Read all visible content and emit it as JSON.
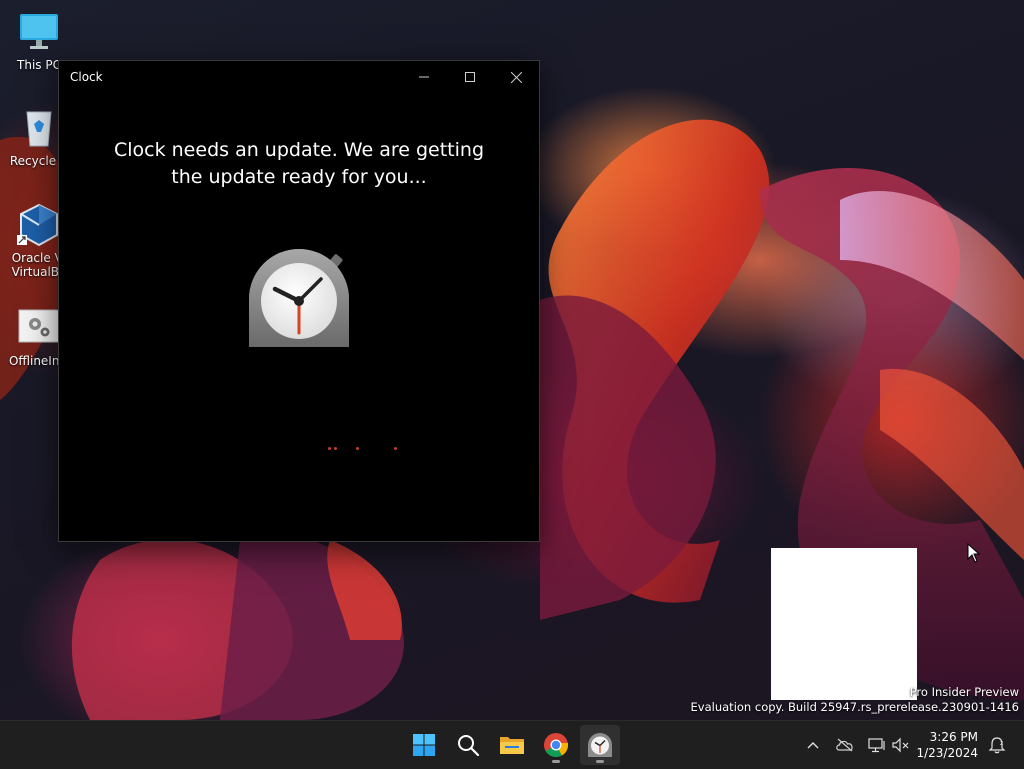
{
  "desktop": {
    "icons": [
      {
        "label": "This PC",
        "icon": "monitor-icon"
      },
      {
        "label": "Recycle B",
        "icon": "recycle-bin-icon"
      },
      {
        "label": "Oracle VI\nVirtualBo",
        "icon": "virtualbox-icon"
      },
      {
        "label": "OfflineInsi",
        "icon": "gear-file-icon"
      }
    ]
  },
  "window": {
    "title": "Clock",
    "message_line1": "Clock needs an update. We are getting",
    "message_line2": "the update ready for you...",
    "icon": "clock-app-icon"
  },
  "watermark": {
    "line1": "Pro Insider Preview",
    "line2": "Evaluation copy. Build 25947.rs_prerelease.230901-1416"
  },
  "taskbar": {
    "items": [
      "start-button",
      "search-button",
      "file-explorer",
      "chrome",
      "clock-app"
    ],
    "time": "3:26 PM",
    "date": "1/23/2024"
  },
  "colors": {
    "accent": "#c43a2f",
    "taskbar": "#1f1f1f",
    "window_bg": "#000000"
  }
}
